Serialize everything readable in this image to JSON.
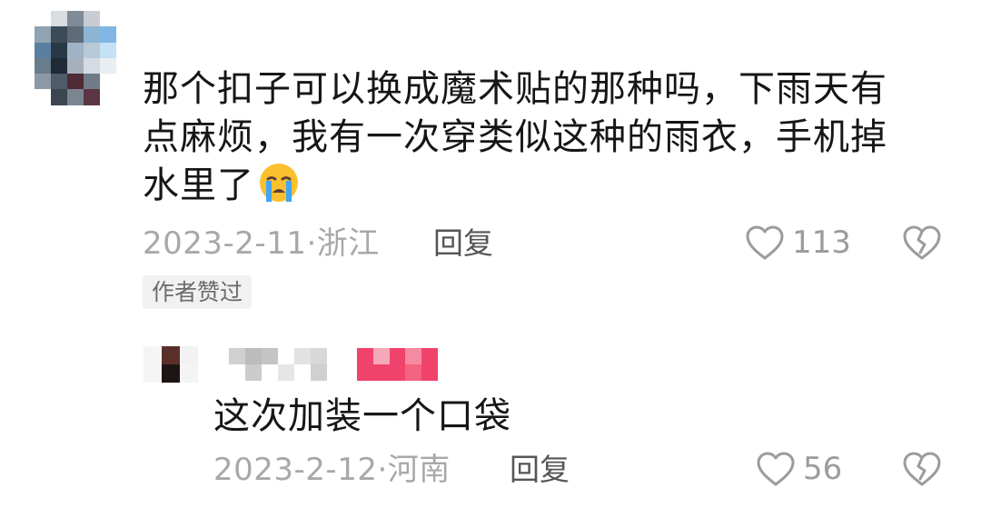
{
  "comments": [
    {
      "text_lines": [
        "那个扣子可以换成魔术贴的那种吗，下雨天有",
        "点麻烦，我有一次穿类似这种的雨衣，手机掉",
        "水里了"
      ],
      "emoji": "loudly-crying-face-emoji",
      "date": "2023-2-11",
      "location": "浙江",
      "reply_label": "回复",
      "likes": "113",
      "badge": "作者赞过"
    }
  ],
  "replies": [
    {
      "text": "这次加装一个口袋",
      "date": "2023-2-12",
      "location": "河南",
      "reply_label": "回复",
      "likes": "56"
    }
  ],
  "icons": {
    "like": "heart-outline-icon",
    "dislike": "broken-heart-icon"
  },
  "colors": {
    "meta": "#a8a8a8",
    "badge_bg": "#f1f1f1",
    "blur_pink": "#f0436b"
  }
}
